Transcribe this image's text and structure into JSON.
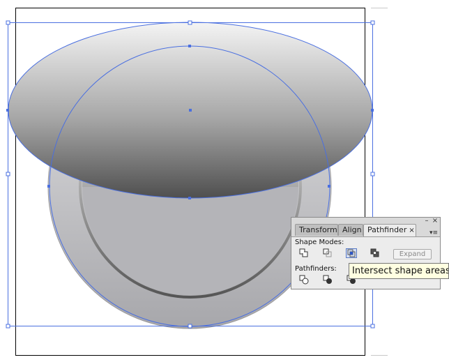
{
  "panel": {
    "tabs": [
      {
        "label": "Transform"
      },
      {
        "label": "Align"
      },
      {
        "label": "Pathfinder",
        "active": true
      }
    ],
    "close_glyph": "×",
    "minimize_glyph": "–",
    "tab_close_glyph": "×",
    "menu_glyph": "▾≡",
    "shape_modes_label": "Shape Modes:",
    "pathfinders_label": "Pathfinders:",
    "expand_label": "Expand",
    "shape_mode_icons": [
      "unite-icon",
      "minus-front-icon",
      "intersect-icon",
      "exclude-icon"
    ],
    "pathfinder_icons": [
      "divide-icon",
      "trim-icon",
      "merge-icon",
      "crop-icon",
      "outline-icon",
      "minus-back-icon"
    ],
    "pressed_icon": "intersect-icon"
  },
  "tooltip": {
    "text": "Intersect shape areas"
  },
  "colors": {
    "selection": "#4a6fe0",
    "panel_bg": "#ececec",
    "tooltip_bg": "#ffffe1"
  }
}
